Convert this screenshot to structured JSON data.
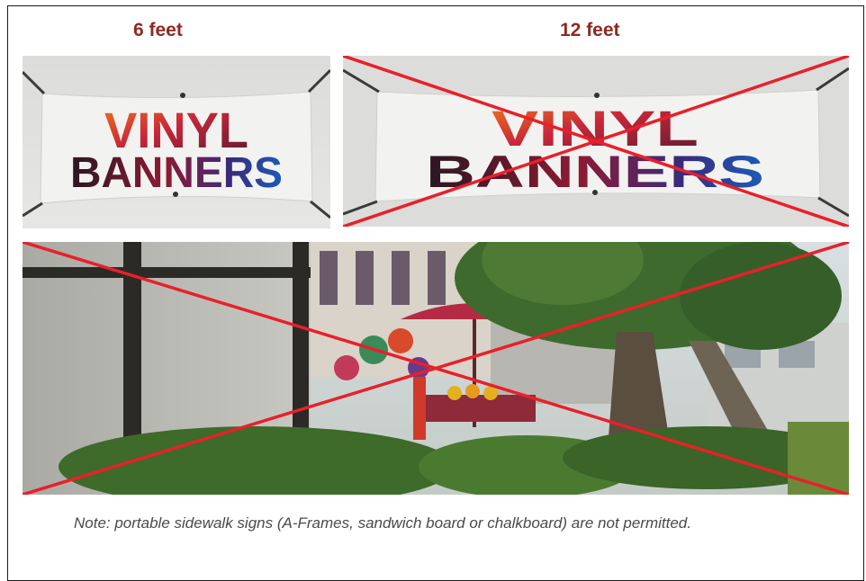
{
  "labels": {
    "small_size": "6 feet",
    "large_size": "12 feet"
  },
  "banners": {
    "line1": "VINYL",
    "line2": "BANNERS",
    "small_permitted": true,
    "large_permitted": false
  },
  "photo": {
    "permitted": false
  },
  "note": "Note: portable sidewalk signs (A-Frames, sandwich board or chalkboard) are not permitted.",
  "colors": {
    "label": "#8e2a22",
    "cross": "#e8202a",
    "banner_top": "#e2571a",
    "banner_mid": "#b21e3c",
    "banner_bottom": "#1f3a8a",
    "note": "#4a4a4a"
  }
}
